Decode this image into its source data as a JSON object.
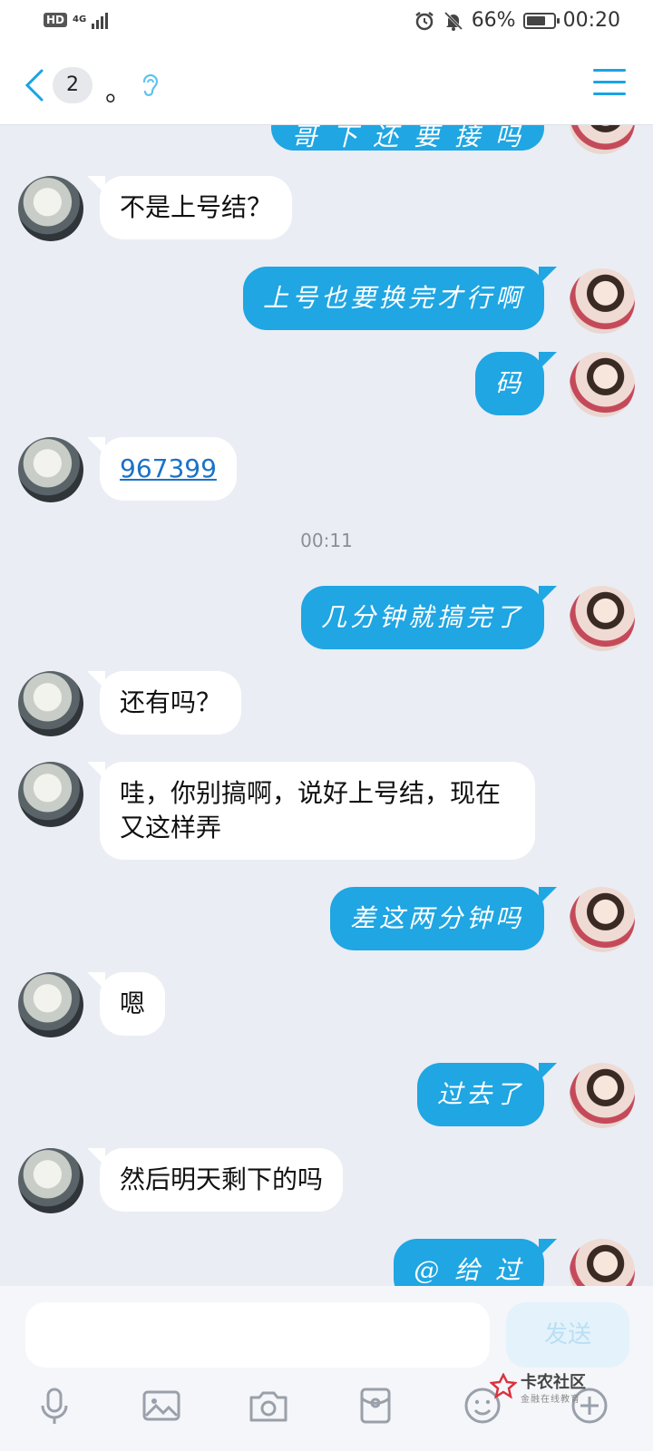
{
  "status_bar": {
    "hd_badge": "HD",
    "network": "4G",
    "battery": "66%",
    "time": "00:20"
  },
  "header": {
    "unread_count": "2",
    "title": "。"
  },
  "messages": [
    {
      "from": "me",
      "text": "哥 下 还 要 接 吗 "
    },
    {
      "from": "other",
      "text": "不是上号结？"
    },
    {
      "from": "me",
      "text": "上号也要换完才行啊"
    },
    {
      "from": "me",
      "text": "码"
    },
    {
      "from": "other",
      "text": "967399"
    },
    {
      "timestamp": "00:11"
    },
    {
      "from": "me",
      "text": "几分钟就搞完了"
    },
    {
      "from": "other",
      "text": "还有吗？"
    },
    {
      "from": "other",
      "text": "哇，你别搞啊，说好上号结，现在又这样弄"
    },
    {
      "from": "me",
      "text": "差这两分钟吗"
    },
    {
      "from": "other",
      "text": "嗯"
    },
    {
      "from": "me",
      "text": "过去了"
    },
    {
      "from": "other",
      "text": "然后明天剩下的吗"
    },
    {
      "from": "me",
      "text": "@ 给 过"
    }
  ],
  "composer": {
    "value": "",
    "send_label": "发送"
  },
  "toolbar": [
    "mic-icon",
    "image-icon",
    "camera-icon",
    "red-packet-icon",
    "emoji-icon",
    "plus-icon"
  ],
  "watermark": {
    "title": "卡农社区",
    "subtitle": "金融在线教育"
  },
  "colors": {
    "bubble_me": "#1fa6e3",
    "bubble_other": "#ffffff",
    "background": "#eaedf4",
    "accent": "#1aa3e6"
  }
}
